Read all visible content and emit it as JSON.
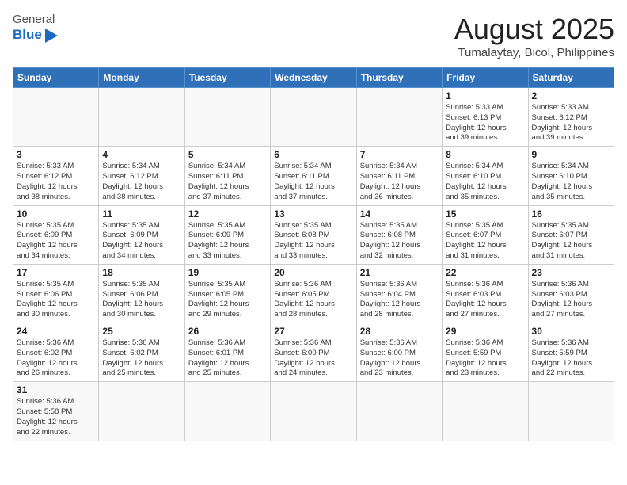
{
  "header": {
    "logo_general": "General",
    "logo_blue": "Blue",
    "title": "August 2025",
    "location": "Tumalaytay, Bicol, Philippines"
  },
  "weekdays": [
    "Sunday",
    "Monday",
    "Tuesday",
    "Wednesday",
    "Thursday",
    "Friday",
    "Saturday"
  ],
  "weeks": [
    [
      {
        "day": "",
        "info": ""
      },
      {
        "day": "",
        "info": ""
      },
      {
        "day": "",
        "info": ""
      },
      {
        "day": "",
        "info": ""
      },
      {
        "day": "",
        "info": ""
      },
      {
        "day": "1",
        "info": "Sunrise: 5:33 AM\nSunset: 6:13 PM\nDaylight: 12 hours\nand 39 minutes."
      },
      {
        "day": "2",
        "info": "Sunrise: 5:33 AM\nSunset: 6:12 PM\nDaylight: 12 hours\nand 39 minutes."
      }
    ],
    [
      {
        "day": "3",
        "info": "Sunrise: 5:33 AM\nSunset: 6:12 PM\nDaylight: 12 hours\nand 38 minutes."
      },
      {
        "day": "4",
        "info": "Sunrise: 5:34 AM\nSunset: 6:12 PM\nDaylight: 12 hours\nand 38 minutes."
      },
      {
        "day": "5",
        "info": "Sunrise: 5:34 AM\nSunset: 6:11 PM\nDaylight: 12 hours\nand 37 minutes."
      },
      {
        "day": "6",
        "info": "Sunrise: 5:34 AM\nSunset: 6:11 PM\nDaylight: 12 hours\nand 37 minutes."
      },
      {
        "day": "7",
        "info": "Sunrise: 5:34 AM\nSunset: 6:11 PM\nDaylight: 12 hours\nand 36 minutes."
      },
      {
        "day": "8",
        "info": "Sunrise: 5:34 AM\nSunset: 6:10 PM\nDaylight: 12 hours\nand 35 minutes."
      },
      {
        "day": "9",
        "info": "Sunrise: 5:34 AM\nSunset: 6:10 PM\nDaylight: 12 hours\nand 35 minutes."
      }
    ],
    [
      {
        "day": "10",
        "info": "Sunrise: 5:35 AM\nSunset: 6:09 PM\nDaylight: 12 hours\nand 34 minutes."
      },
      {
        "day": "11",
        "info": "Sunrise: 5:35 AM\nSunset: 6:09 PM\nDaylight: 12 hours\nand 34 minutes."
      },
      {
        "day": "12",
        "info": "Sunrise: 5:35 AM\nSunset: 6:09 PM\nDaylight: 12 hours\nand 33 minutes."
      },
      {
        "day": "13",
        "info": "Sunrise: 5:35 AM\nSunset: 6:08 PM\nDaylight: 12 hours\nand 33 minutes."
      },
      {
        "day": "14",
        "info": "Sunrise: 5:35 AM\nSunset: 6:08 PM\nDaylight: 12 hours\nand 32 minutes."
      },
      {
        "day": "15",
        "info": "Sunrise: 5:35 AM\nSunset: 6:07 PM\nDaylight: 12 hours\nand 31 minutes."
      },
      {
        "day": "16",
        "info": "Sunrise: 5:35 AM\nSunset: 6:07 PM\nDaylight: 12 hours\nand 31 minutes."
      }
    ],
    [
      {
        "day": "17",
        "info": "Sunrise: 5:35 AM\nSunset: 6:06 PM\nDaylight: 12 hours\nand 30 minutes."
      },
      {
        "day": "18",
        "info": "Sunrise: 5:35 AM\nSunset: 6:06 PM\nDaylight: 12 hours\nand 30 minutes."
      },
      {
        "day": "19",
        "info": "Sunrise: 5:35 AM\nSunset: 6:05 PM\nDaylight: 12 hours\nand 29 minutes."
      },
      {
        "day": "20",
        "info": "Sunrise: 5:36 AM\nSunset: 6:05 PM\nDaylight: 12 hours\nand 28 minutes."
      },
      {
        "day": "21",
        "info": "Sunrise: 5:36 AM\nSunset: 6:04 PM\nDaylight: 12 hours\nand 28 minutes."
      },
      {
        "day": "22",
        "info": "Sunrise: 5:36 AM\nSunset: 6:03 PM\nDaylight: 12 hours\nand 27 minutes."
      },
      {
        "day": "23",
        "info": "Sunrise: 5:36 AM\nSunset: 6:03 PM\nDaylight: 12 hours\nand 27 minutes."
      }
    ],
    [
      {
        "day": "24",
        "info": "Sunrise: 5:36 AM\nSunset: 6:02 PM\nDaylight: 12 hours\nand 26 minutes."
      },
      {
        "day": "25",
        "info": "Sunrise: 5:36 AM\nSunset: 6:02 PM\nDaylight: 12 hours\nand 25 minutes."
      },
      {
        "day": "26",
        "info": "Sunrise: 5:36 AM\nSunset: 6:01 PM\nDaylight: 12 hours\nand 25 minutes."
      },
      {
        "day": "27",
        "info": "Sunrise: 5:36 AM\nSunset: 6:00 PM\nDaylight: 12 hours\nand 24 minutes."
      },
      {
        "day": "28",
        "info": "Sunrise: 5:36 AM\nSunset: 6:00 PM\nDaylight: 12 hours\nand 23 minutes."
      },
      {
        "day": "29",
        "info": "Sunrise: 5:36 AM\nSunset: 5:59 PM\nDaylight: 12 hours\nand 23 minutes."
      },
      {
        "day": "30",
        "info": "Sunrise: 5:36 AM\nSunset: 5:59 PM\nDaylight: 12 hours\nand 22 minutes."
      }
    ],
    [
      {
        "day": "31",
        "info": "Sunrise: 5:36 AM\nSunset: 5:58 PM\nDaylight: 12 hours\nand 22 minutes."
      },
      {
        "day": "",
        "info": ""
      },
      {
        "day": "",
        "info": ""
      },
      {
        "day": "",
        "info": ""
      },
      {
        "day": "",
        "info": ""
      },
      {
        "day": "",
        "info": ""
      },
      {
        "day": "",
        "info": ""
      }
    ]
  ]
}
